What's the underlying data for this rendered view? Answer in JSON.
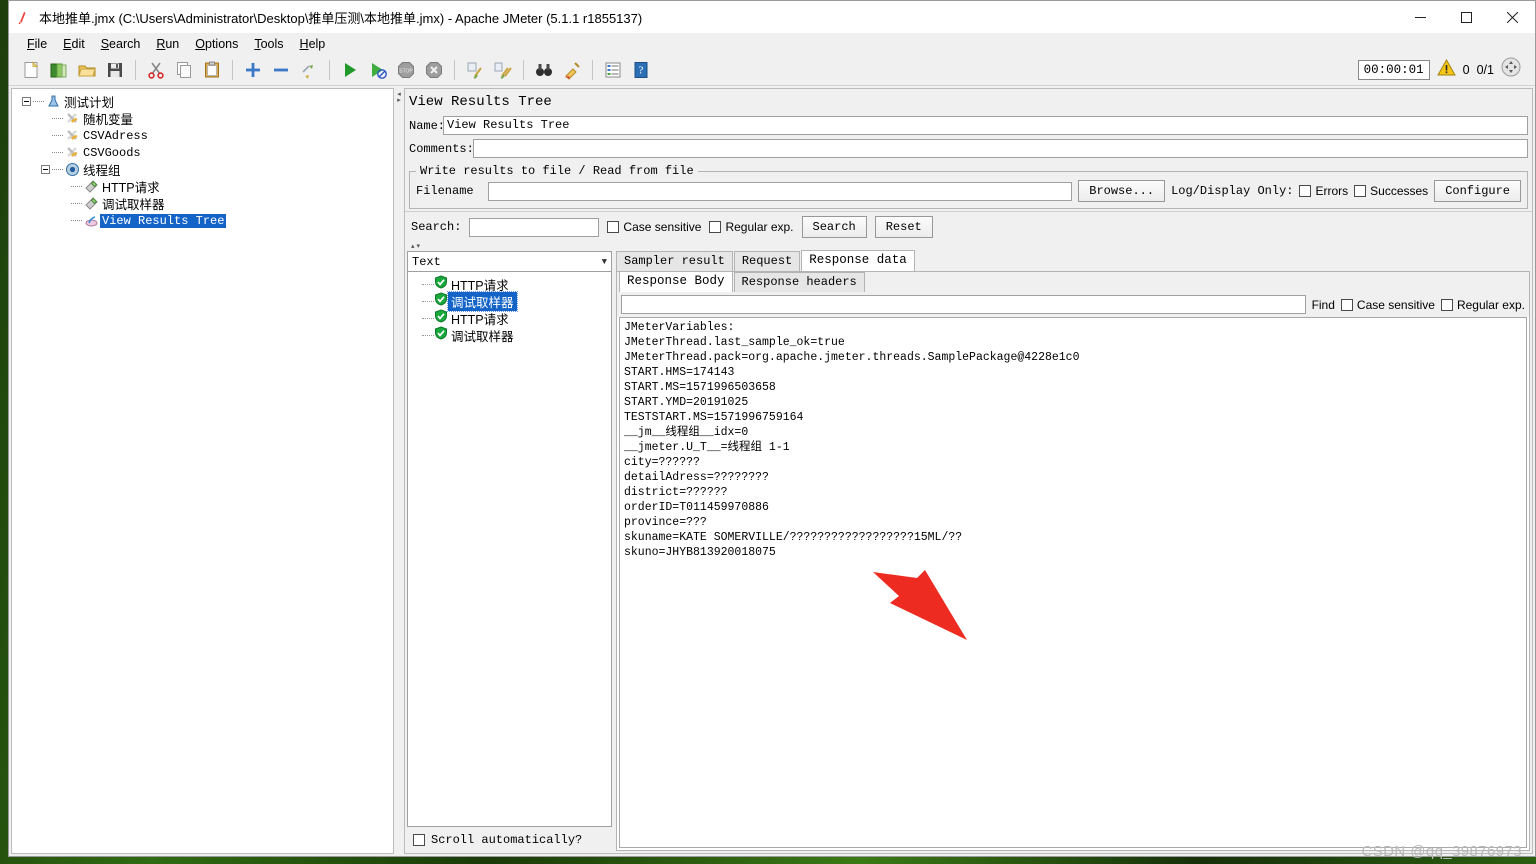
{
  "window": {
    "title": "本地推单.jmx (C:\\Users\\Administrator\\Desktop\\推单压测\\本地推单.jmx) - Apache JMeter (5.1.1 r1855137)",
    "minimize": "—",
    "maximize": "□",
    "close": "✕"
  },
  "menubar": {
    "items": [
      {
        "label": "File",
        "mnemonic": "F",
        "rest": "ile"
      },
      {
        "label": "Edit",
        "mnemonic": "E",
        "rest": "dit"
      },
      {
        "label": "Search",
        "mnemonic": "S",
        "rest": "earch"
      },
      {
        "label": "Run",
        "mnemonic": "R",
        "rest": "un"
      },
      {
        "label": "Options",
        "mnemonic": "O",
        "rest": "ptions"
      },
      {
        "label": "Tools",
        "mnemonic": "T",
        "rest": "ools"
      },
      {
        "label": "Help",
        "mnemonic": "H",
        "rest": "elp"
      }
    ]
  },
  "toolbar": {
    "icons": [
      "new-file-icon",
      "open-templates-icon",
      "open-folder-icon",
      "save-icon",
      "cut-icon",
      "copy-icon",
      "paste-icon",
      "expand-all-icon",
      "collapse-all-icon",
      "toggle-icon",
      "start-icon",
      "start-no-pause-icon",
      "stop-icon",
      "shutdown-icon",
      "clear-icon",
      "clear-all-icon",
      "search-binoculars-icon",
      "search-reset-broom-icon",
      "function-helper-icon",
      "help-icon"
    ],
    "timer": "00:00:01",
    "warning_icon": "warning-triangle-icon",
    "error_count": "0",
    "thread_count": "0/1",
    "remote_icon": "expand-arrows-icon"
  },
  "tree": {
    "nodes": [
      {
        "label": "测试计划",
        "depth": 0,
        "icon": "test-plan-icon",
        "toggle": "minus",
        "selected": false,
        "mono": false
      },
      {
        "label": "随机变量",
        "depth": 1,
        "icon": "config-element-icon",
        "toggle": "none",
        "selected": false,
        "mono": false
      },
      {
        "label": "CSVAdress",
        "depth": 1,
        "icon": "config-element-icon",
        "toggle": "none",
        "selected": false,
        "mono": true
      },
      {
        "label": "CSVGoods",
        "depth": 1,
        "icon": "config-element-icon",
        "toggle": "none",
        "selected": false,
        "mono": true
      },
      {
        "label": "线程组",
        "depth": 1,
        "icon": "thread-group-icon",
        "toggle": "minus",
        "selected": false,
        "mono": false
      },
      {
        "label": "HTTP请求",
        "depth": 2,
        "icon": "sampler-icon",
        "toggle": "none",
        "selected": false,
        "mono": false
      },
      {
        "label": "调试取样器",
        "depth": 2,
        "icon": "sampler-icon",
        "toggle": "none",
        "selected": false,
        "mono": false
      },
      {
        "label": "View Results Tree",
        "depth": 2,
        "icon": "listener-icon",
        "toggle": "none",
        "selected": true,
        "mono": true
      }
    ]
  },
  "panel": {
    "title": "View Results Tree",
    "name_label": "Name:",
    "name_value": "View Results Tree",
    "comments_label": "Comments:",
    "comments_value": "",
    "file_group_legend": "Write results to file / Read from file",
    "filename_label": "Filename",
    "filename_value": "",
    "browse_button": "Browse...",
    "log_display_label": "Log/Display Only:",
    "errors_checkbox": "Errors",
    "errors_checked": false,
    "successes_checkbox": "Successes",
    "successes_checked": false,
    "configure_button": "Configure"
  },
  "search_bar": {
    "label": "Search:",
    "value": "",
    "case_sensitive": "Case sensitive",
    "case_sensitive_checked": false,
    "regular_exp": "Regular exp.",
    "regular_exp_checked": false,
    "search_button": "Search",
    "reset_button": "Reset"
  },
  "results": {
    "renderer_selected": "Text",
    "renderer_caret": "chevron-down-icon",
    "items": [
      {
        "label": "HTTP请求",
        "status": "success",
        "selected": false
      },
      {
        "label": "调试取样器",
        "status": "success",
        "selected": true
      },
      {
        "label": "HTTP请求",
        "status": "success",
        "selected": false
      },
      {
        "label": "调试取样器",
        "status": "success",
        "selected": false
      }
    ],
    "scroll_auto_label": "Scroll automatically?",
    "scroll_auto_checked": false
  },
  "detail": {
    "tabs": [
      {
        "label": "Sampler result",
        "active": false
      },
      {
        "label": "Request",
        "active": false
      },
      {
        "label": "Response data",
        "active": true
      }
    ],
    "subtabs": [
      {
        "label": "Response Body",
        "active": true
      },
      {
        "label": "Response headers",
        "active": false
      }
    ],
    "find_input": "",
    "find_label": "Find",
    "find_case_sensitive": "Case sensitive",
    "find_case_sensitive_checked": false,
    "find_regular_exp": "Regular exp.",
    "find_regular_exp_checked": false,
    "response_body": "JMeterVariables:\nJMeterThread.last_sample_ok=true\nJMeterThread.pack=org.apache.jmeter.threads.SamplePackage@4228e1c0\nSTART.HMS=174143\nSTART.MS=1571996503658\nSTART.YMD=20191025\nTESTSTART.MS=1571996759164\n__jm__线程组__idx=0\n__jmeter.U_T__=线程组 1-1\ncity=??????\ndetailAdress=????????\ndistrict=??????\norderID=T011459970886\nprovince=???\nskuname=KATE SOMERVILLE/??????????????????15ML/??\nskuno=JHYB813920018075"
  },
  "annotation": {
    "arrow": "red-arrow-annotation",
    "arrow_color": "#ee2b20"
  },
  "watermark": "CSDN @qq_39876973",
  "colors": {
    "selection_blue": "#1464c8",
    "window_bg": "#f0f0f0",
    "desktop_green": "#2f6b12"
  }
}
